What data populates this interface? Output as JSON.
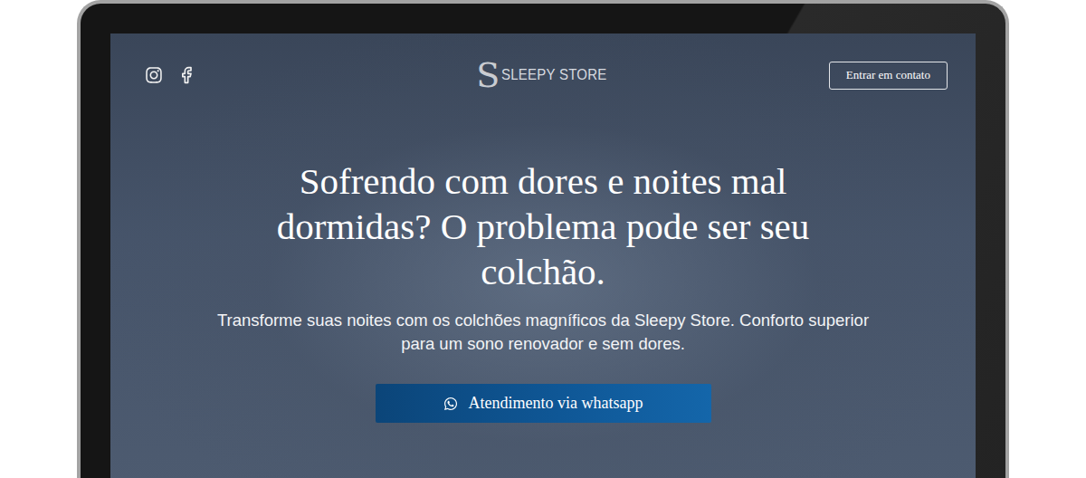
{
  "header": {
    "logo": {
      "mark": "S",
      "text": "SLEEPY STORE"
    },
    "contact_button": "Entrar em contato"
  },
  "hero": {
    "title": "Sofrendo com dores e noites mal dormidas? O problema pode ser seu colchão.",
    "subtitle": "Transforme suas noites com os colchões magníficos da Sleepy Store. Conforto superior para um sono renovador e sem dores.",
    "cta": "Atendimento via whatsapp"
  }
}
